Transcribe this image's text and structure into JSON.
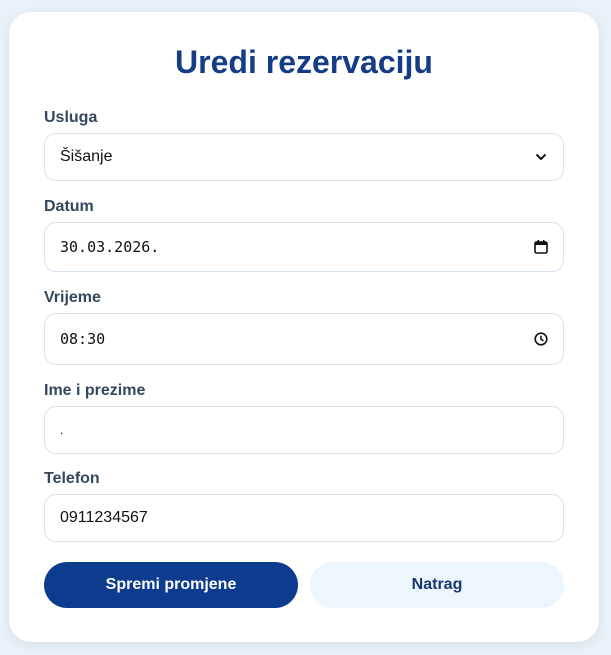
{
  "form": {
    "title": "Uredi rezervaciju",
    "service": {
      "label": "Usluga",
      "value": "Šišanje",
      "icon": "chevron-down-icon"
    },
    "date": {
      "label": "Datum",
      "value": "30.03.2026.",
      "icon": "calendar-icon"
    },
    "time": {
      "label": "Vrijeme",
      "value": "08:30",
      "icon": "clock-icon"
    },
    "name": {
      "label": "Ime i prezime",
      "value": "."
    },
    "phone": {
      "label": "Telefon",
      "value": "0911234567"
    }
  },
  "actions": {
    "save_label": "Spremi promjene",
    "back_label": "Natrag"
  },
  "colors": {
    "primary": "#0d3b8d",
    "title": "#143d86",
    "secondary_bg": "#edf5fd",
    "page_bg": "#eaf1f8"
  }
}
